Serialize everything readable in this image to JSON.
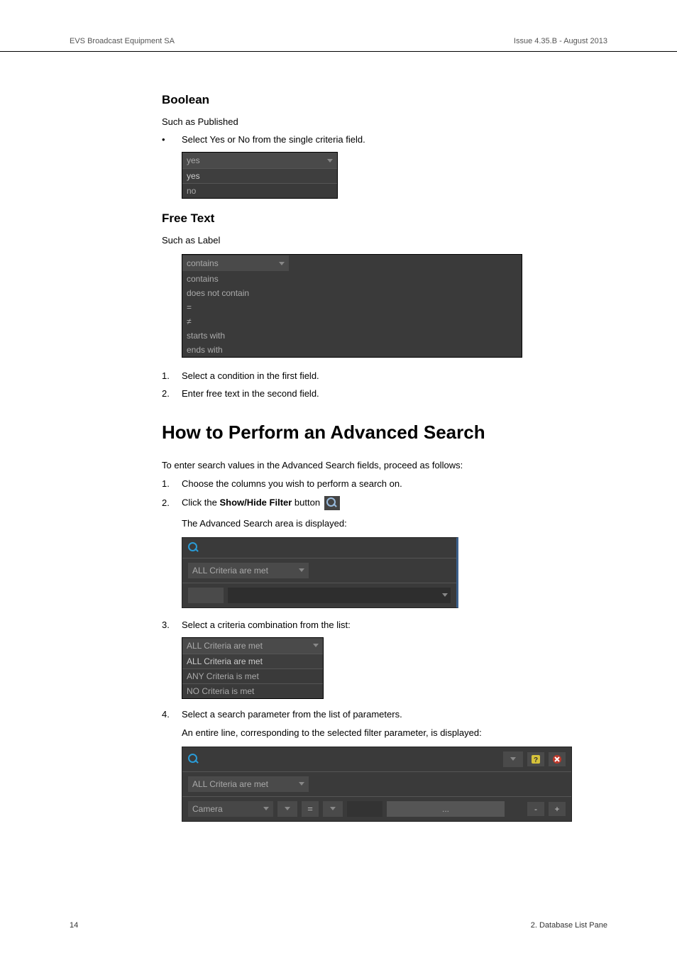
{
  "header": {
    "left": "EVS Broadcast Equipment SA",
    "right": "Issue 4.35.B - August 2013"
  },
  "boolean": {
    "heading": "Boolean",
    "desc": "Such as Published",
    "bullet": "Select Yes or No from the single criteria field.",
    "sel": "yes",
    "opts": [
      "yes",
      "no"
    ]
  },
  "freetext": {
    "heading": "Free Text",
    "desc": "Such as Label",
    "sel": "contains",
    "opts": [
      "contains",
      "does not contain",
      "=",
      "≠",
      "starts with",
      "ends with"
    ],
    "step1": "Select a condition in the first field.",
    "step2": "Enter free text in the second field."
  },
  "section": {
    "title": "How to Perform an Advanced Search",
    "intro": "To enter search values in the Advanced Search fields, proceed as follows:",
    "step1": "Choose the columns you wish to perform a search on.",
    "step2a": "Click the ",
    "step2b": "Show/Hide Filter",
    "step2c": " button",
    "result2": "The Advanced Search area is displayed:",
    "allcrit": "ALL Criteria are met",
    "step3": "Select a criteria combination from the list:",
    "combo_sel": "ALL Criteria are met",
    "combo_opts": [
      "ALL Criteria are met",
      "ANY Criteria is met",
      "NO Criteria is met"
    ],
    "step4": "Select a search parameter from the list of parameters.",
    "step4_result": "An entire line, corresponding to the selected filter parameter, is displayed:",
    "camera": "Camera",
    "eq": "=",
    "dots": "...",
    "minus": "-",
    "plus": "+"
  },
  "footer": {
    "page": "14",
    "section": "2. Database List Pane"
  }
}
